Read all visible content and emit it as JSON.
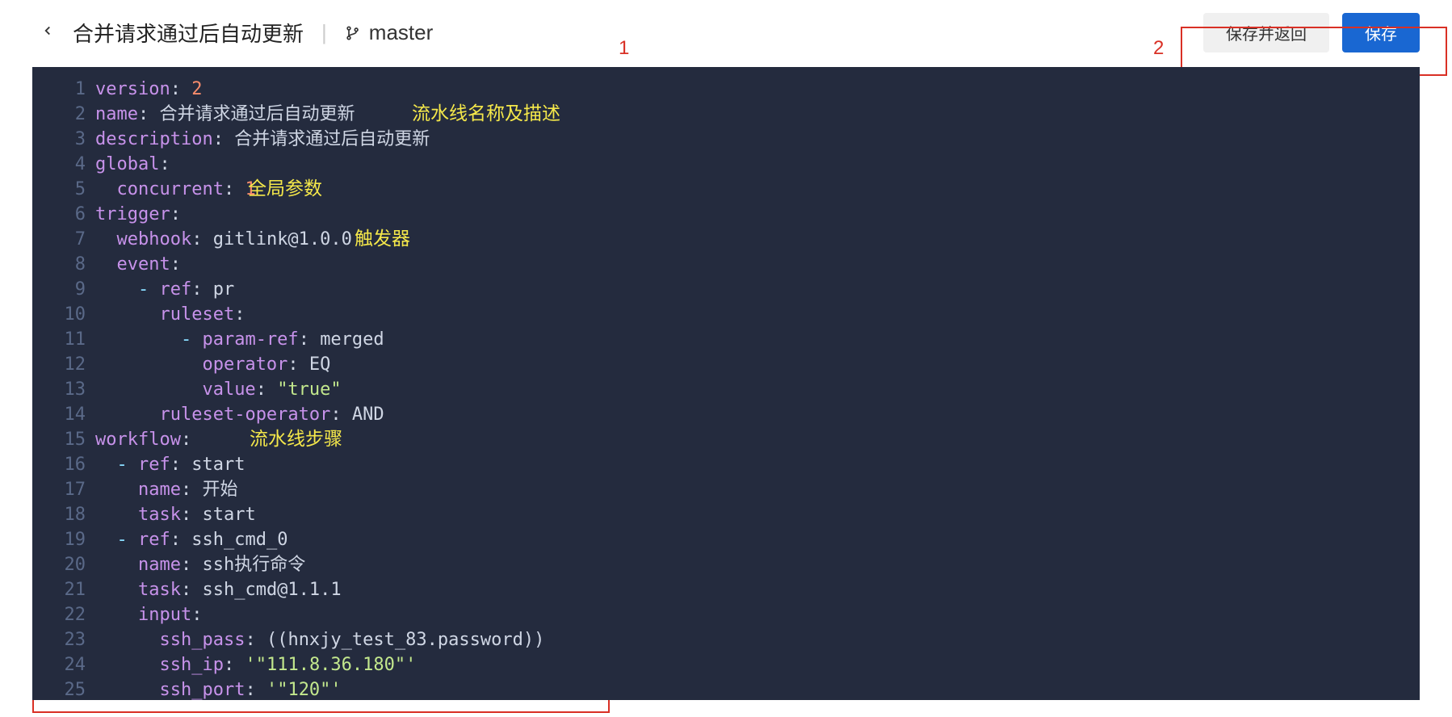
{
  "header": {
    "title": "合并请求通过后自动更新",
    "branch": "master",
    "save_return_label": "保存并返回",
    "save_label": "保存"
  },
  "callouts": {
    "one": "1",
    "two": "2"
  },
  "annotations": {
    "name_desc": "流水线名称及描述",
    "global_params": "全局参数",
    "trigger": "触发器",
    "workflow_steps": "流水线步骤"
  },
  "yaml": {
    "version_key": "version",
    "version_val": "2",
    "name_key": "name",
    "name_val": "合并请求通过后自动更新",
    "description_key": "description",
    "description_val": "合并请求通过后自动更新",
    "global_key": "global",
    "concurrent_key": "concurrent",
    "concurrent_val": "1",
    "trigger_key": "trigger",
    "webhook_key": "webhook",
    "webhook_val": "gitlink@1.0.0",
    "event_key": "event",
    "ref_key": "ref",
    "ref_val_pr": "pr",
    "ruleset_key": "ruleset",
    "param_ref_key": "param-ref",
    "param_ref_val": "merged",
    "operator_key": "operator",
    "operator_val": "EQ",
    "value_key": "value",
    "value_val": "\"true\"",
    "ruleset_op_key": "ruleset-operator",
    "ruleset_op_val": "AND",
    "workflow_key": "workflow",
    "start_val": "start",
    "task_key": "task",
    "name_inner_key": "name",
    "start_name_val": "开始",
    "ref_ssh_val": "ssh_cmd_0",
    "ssh_name_val": "ssh执行命令",
    "ssh_task_val": "ssh_cmd@1.1.1",
    "input_key": "input",
    "ssh_pass_key": "ssh_pass",
    "ssh_pass_val": "((hnxjy_test_83.password))",
    "ssh_ip_key": "ssh_ip",
    "ssh_ip_val": "'\"111.8.36.180\"'",
    "ssh_port_key": "ssh_port",
    "ssh_port_val": "'\"120\"'"
  },
  "line_numbers": [
    "1",
    "2",
    "3",
    "4",
    "5",
    "6",
    "7",
    "8",
    "9",
    "10",
    "11",
    "12",
    "13",
    "14",
    "15",
    "16",
    "17",
    "18",
    "19",
    "20",
    "21",
    "22",
    "23",
    "24",
    "25"
  ]
}
